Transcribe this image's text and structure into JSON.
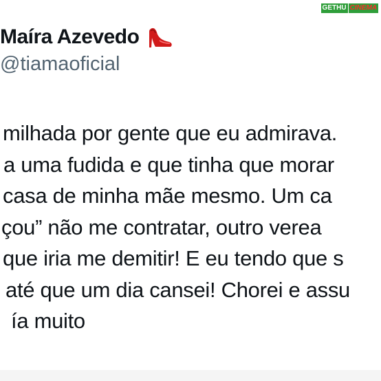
{
  "watermark": {
    "part1": "GETHU",
    "part2": "CINEMA"
  },
  "tweet": {
    "author_name": "Maíra Azevedo",
    "author_emoji": "high-heel-icon",
    "handle": "@tiamaoficial",
    "lines": [
      "milhada por gente que eu admirava.",
      "a uma fudida e que tinha que morar",
      "casa de minha mãe mesmo. Um ca",
      "çou” não me contratar, outro verea",
      "que iria me demitir! E eu tendo que s",
      "até que um dia cansei! Chorei e assu",
      "ía muito"
    ]
  },
  "colors": {
    "text": "#0f1419",
    "handle": "#536471",
    "heel": "#d11a1a",
    "watermark_bg": "#2f9e3a",
    "watermark_accent": "#ff2a2a"
  }
}
